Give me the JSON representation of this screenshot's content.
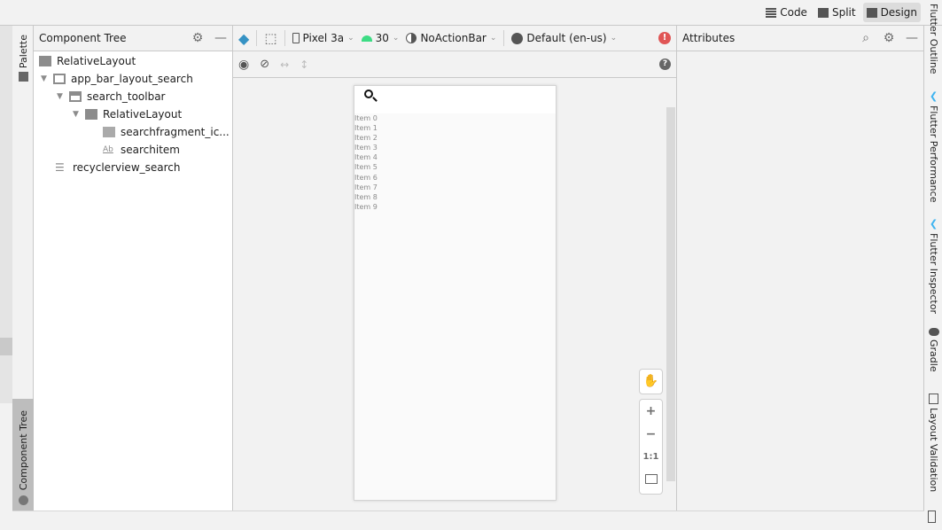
{
  "view_modes": [
    {
      "label": "Code",
      "icon": "code-lines-icon"
    },
    {
      "label": "Split",
      "icon": "split-icon"
    },
    {
      "label": "Design",
      "icon": "image-icon",
      "active": true
    }
  ],
  "left_tools": {
    "palette": "Palette",
    "component_tree": "Component Tree"
  },
  "component_tree": {
    "title": "Component Tree",
    "nodes": [
      {
        "label": "RelativeLayout",
        "depth": 0,
        "icon": "relative-layout-icon",
        "expanded": null
      },
      {
        "label": "app_bar_layout_search",
        "depth": 1,
        "icon": "app-bar-icon",
        "expanded": true
      },
      {
        "label": "search_toolbar",
        "depth": 2,
        "icon": "toolbar-icon",
        "expanded": true
      },
      {
        "label": "RelativeLayout",
        "depth": 3,
        "icon": "relative-layout-icon",
        "expanded": true
      },
      {
        "label": "searchfragment_ic...",
        "depth": 4,
        "icon": "image-view-icon",
        "expanded": null
      },
      {
        "label": "searchitem",
        "depth": 4,
        "icon": "text-view-icon",
        "expanded": null
      },
      {
        "label": "recyclerview_search",
        "depth": 1,
        "icon": "list-icon",
        "expanded": null
      }
    ]
  },
  "design_toolbar": {
    "device": "Pixel 3a",
    "api": "30",
    "theme": "NoActionBar",
    "locale": "Default (en-us)",
    "api_color": "#3ddc84",
    "error_color": "#e05555",
    "layers_color": "#3592c4"
  },
  "preview": {
    "items": [
      "Item 0",
      "Item 1",
      "Item 2",
      "Item 3",
      "Item 4",
      "Item 5",
      "Item 6",
      "Item 7",
      "Item 8",
      "Item 9"
    ]
  },
  "zoom_controls": {
    "plus": "+",
    "minus": "−",
    "actual": "1:1"
  },
  "attributes": {
    "title": "Attributes"
  },
  "right_tools": [
    "Flutter Outline",
    "Flutter Performance",
    "Flutter Inspector",
    "Gradle",
    "Layout Validation"
  ]
}
